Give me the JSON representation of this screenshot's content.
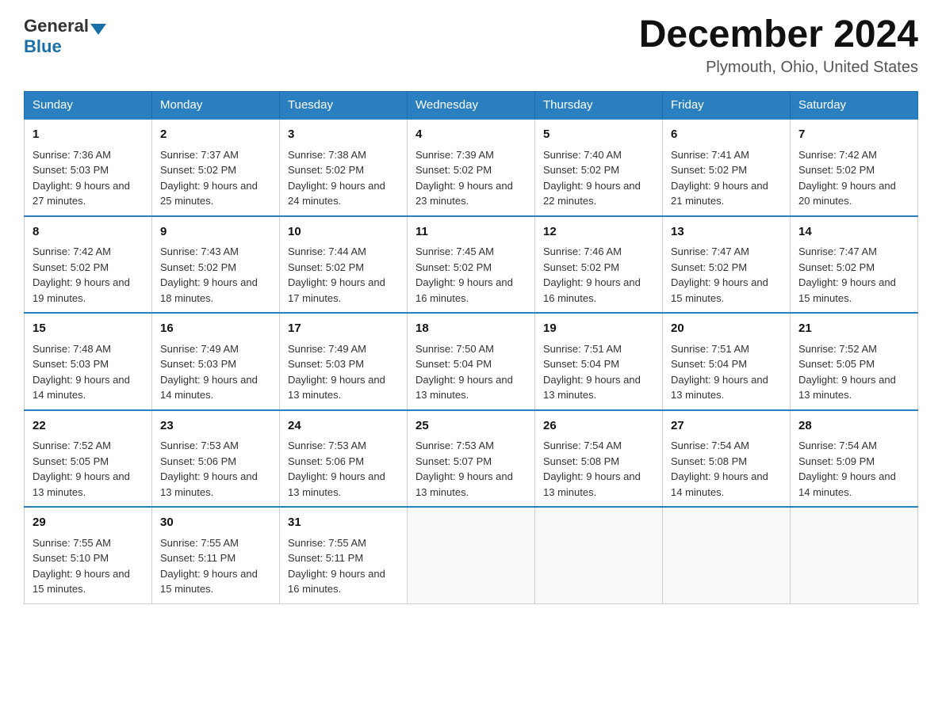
{
  "header": {
    "logo_general": "General",
    "logo_blue": "Blue",
    "month_title": "December 2024",
    "location": "Plymouth, Ohio, United States"
  },
  "days_of_week": [
    "Sunday",
    "Monday",
    "Tuesday",
    "Wednesday",
    "Thursday",
    "Friday",
    "Saturday"
  ],
  "weeks": [
    [
      {
        "day": "1",
        "sunrise": "Sunrise: 7:36 AM",
        "sunset": "Sunset: 5:03 PM",
        "daylight": "Daylight: 9 hours and 27 minutes."
      },
      {
        "day": "2",
        "sunrise": "Sunrise: 7:37 AM",
        "sunset": "Sunset: 5:02 PM",
        "daylight": "Daylight: 9 hours and 25 minutes."
      },
      {
        "day": "3",
        "sunrise": "Sunrise: 7:38 AM",
        "sunset": "Sunset: 5:02 PM",
        "daylight": "Daylight: 9 hours and 24 minutes."
      },
      {
        "day": "4",
        "sunrise": "Sunrise: 7:39 AM",
        "sunset": "Sunset: 5:02 PM",
        "daylight": "Daylight: 9 hours and 23 minutes."
      },
      {
        "day": "5",
        "sunrise": "Sunrise: 7:40 AM",
        "sunset": "Sunset: 5:02 PM",
        "daylight": "Daylight: 9 hours and 22 minutes."
      },
      {
        "day": "6",
        "sunrise": "Sunrise: 7:41 AM",
        "sunset": "Sunset: 5:02 PM",
        "daylight": "Daylight: 9 hours and 21 minutes."
      },
      {
        "day": "7",
        "sunrise": "Sunrise: 7:42 AM",
        "sunset": "Sunset: 5:02 PM",
        "daylight": "Daylight: 9 hours and 20 minutes."
      }
    ],
    [
      {
        "day": "8",
        "sunrise": "Sunrise: 7:42 AM",
        "sunset": "Sunset: 5:02 PM",
        "daylight": "Daylight: 9 hours and 19 minutes."
      },
      {
        "day": "9",
        "sunrise": "Sunrise: 7:43 AM",
        "sunset": "Sunset: 5:02 PM",
        "daylight": "Daylight: 9 hours and 18 minutes."
      },
      {
        "day": "10",
        "sunrise": "Sunrise: 7:44 AM",
        "sunset": "Sunset: 5:02 PM",
        "daylight": "Daylight: 9 hours and 17 minutes."
      },
      {
        "day": "11",
        "sunrise": "Sunrise: 7:45 AM",
        "sunset": "Sunset: 5:02 PM",
        "daylight": "Daylight: 9 hours and 16 minutes."
      },
      {
        "day": "12",
        "sunrise": "Sunrise: 7:46 AM",
        "sunset": "Sunset: 5:02 PM",
        "daylight": "Daylight: 9 hours and 16 minutes."
      },
      {
        "day": "13",
        "sunrise": "Sunrise: 7:47 AM",
        "sunset": "Sunset: 5:02 PM",
        "daylight": "Daylight: 9 hours and 15 minutes."
      },
      {
        "day": "14",
        "sunrise": "Sunrise: 7:47 AM",
        "sunset": "Sunset: 5:02 PM",
        "daylight": "Daylight: 9 hours and 15 minutes."
      }
    ],
    [
      {
        "day": "15",
        "sunrise": "Sunrise: 7:48 AM",
        "sunset": "Sunset: 5:03 PM",
        "daylight": "Daylight: 9 hours and 14 minutes."
      },
      {
        "day": "16",
        "sunrise": "Sunrise: 7:49 AM",
        "sunset": "Sunset: 5:03 PM",
        "daylight": "Daylight: 9 hours and 14 minutes."
      },
      {
        "day": "17",
        "sunrise": "Sunrise: 7:49 AM",
        "sunset": "Sunset: 5:03 PM",
        "daylight": "Daylight: 9 hours and 13 minutes."
      },
      {
        "day": "18",
        "sunrise": "Sunrise: 7:50 AM",
        "sunset": "Sunset: 5:04 PM",
        "daylight": "Daylight: 9 hours and 13 minutes."
      },
      {
        "day": "19",
        "sunrise": "Sunrise: 7:51 AM",
        "sunset": "Sunset: 5:04 PM",
        "daylight": "Daylight: 9 hours and 13 minutes."
      },
      {
        "day": "20",
        "sunrise": "Sunrise: 7:51 AM",
        "sunset": "Sunset: 5:04 PM",
        "daylight": "Daylight: 9 hours and 13 minutes."
      },
      {
        "day": "21",
        "sunrise": "Sunrise: 7:52 AM",
        "sunset": "Sunset: 5:05 PM",
        "daylight": "Daylight: 9 hours and 13 minutes."
      }
    ],
    [
      {
        "day": "22",
        "sunrise": "Sunrise: 7:52 AM",
        "sunset": "Sunset: 5:05 PM",
        "daylight": "Daylight: 9 hours and 13 minutes."
      },
      {
        "day": "23",
        "sunrise": "Sunrise: 7:53 AM",
        "sunset": "Sunset: 5:06 PM",
        "daylight": "Daylight: 9 hours and 13 minutes."
      },
      {
        "day": "24",
        "sunrise": "Sunrise: 7:53 AM",
        "sunset": "Sunset: 5:06 PM",
        "daylight": "Daylight: 9 hours and 13 minutes."
      },
      {
        "day": "25",
        "sunrise": "Sunrise: 7:53 AM",
        "sunset": "Sunset: 5:07 PM",
        "daylight": "Daylight: 9 hours and 13 minutes."
      },
      {
        "day": "26",
        "sunrise": "Sunrise: 7:54 AM",
        "sunset": "Sunset: 5:08 PM",
        "daylight": "Daylight: 9 hours and 13 minutes."
      },
      {
        "day": "27",
        "sunrise": "Sunrise: 7:54 AM",
        "sunset": "Sunset: 5:08 PM",
        "daylight": "Daylight: 9 hours and 14 minutes."
      },
      {
        "day": "28",
        "sunrise": "Sunrise: 7:54 AM",
        "sunset": "Sunset: 5:09 PM",
        "daylight": "Daylight: 9 hours and 14 minutes."
      }
    ],
    [
      {
        "day": "29",
        "sunrise": "Sunrise: 7:55 AM",
        "sunset": "Sunset: 5:10 PM",
        "daylight": "Daylight: 9 hours and 15 minutes."
      },
      {
        "day": "30",
        "sunrise": "Sunrise: 7:55 AM",
        "sunset": "Sunset: 5:11 PM",
        "daylight": "Daylight: 9 hours and 15 minutes."
      },
      {
        "day": "31",
        "sunrise": "Sunrise: 7:55 AM",
        "sunset": "Sunset: 5:11 PM",
        "daylight": "Daylight: 9 hours and 16 minutes."
      },
      null,
      null,
      null,
      null
    ]
  ]
}
